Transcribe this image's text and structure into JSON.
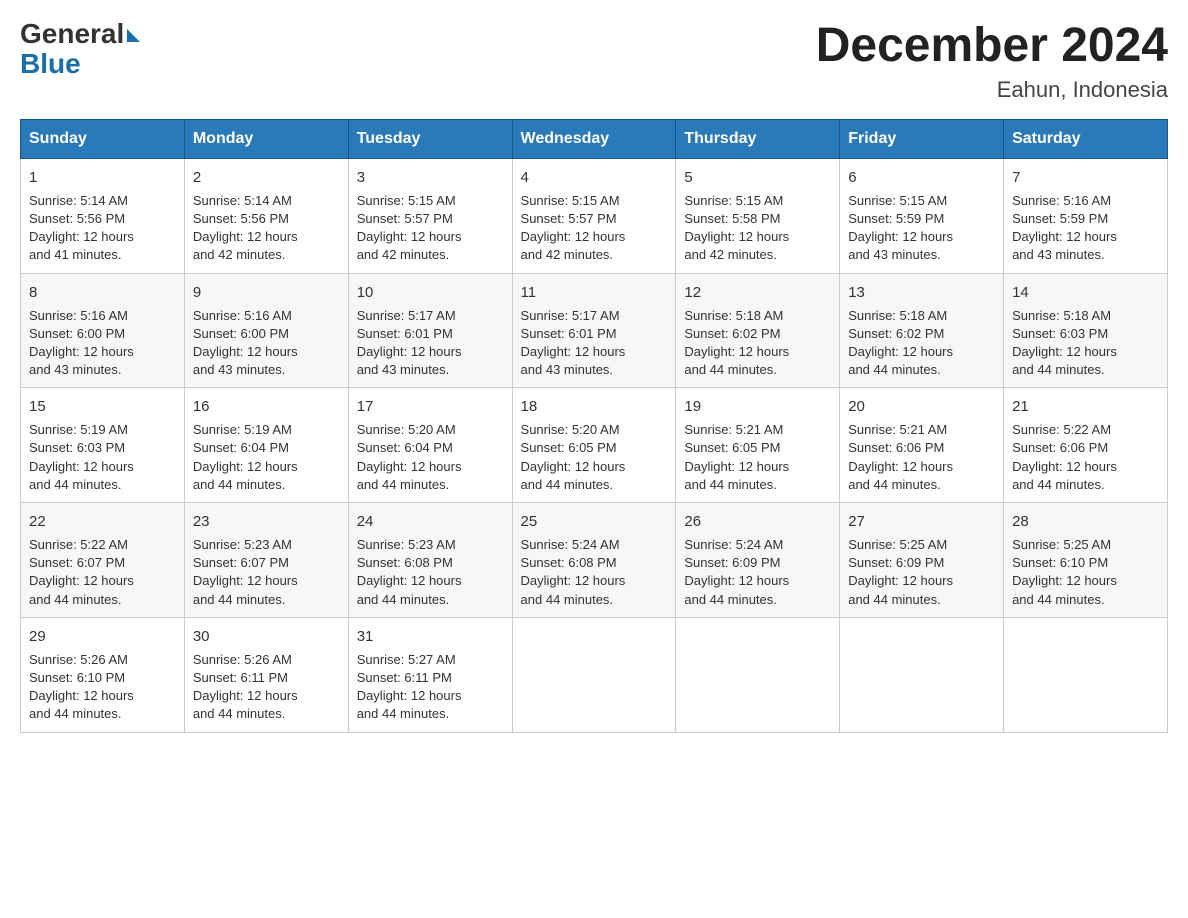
{
  "logo": {
    "general": "General",
    "blue": "Blue"
  },
  "header": {
    "month": "December 2024",
    "location": "Eahun, Indonesia"
  },
  "days_of_week": [
    "Sunday",
    "Monday",
    "Tuesday",
    "Wednesday",
    "Thursday",
    "Friday",
    "Saturday"
  ],
  "weeks": [
    [
      {
        "day": "1",
        "sunrise": "5:14 AM",
        "sunset": "5:56 PM",
        "daylight": "12 hours and 41 minutes."
      },
      {
        "day": "2",
        "sunrise": "5:14 AM",
        "sunset": "5:56 PM",
        "daylight": "12 hours and 42 minutes."
      },
      {
        "day": "3",
        "sunrise": "5:15 AM",
        "sunset": "5:57 PM",
        "daylight": "12 hours and 42 minutes."
      },
      {
        "day": "4",
        "sunrise": "5:15 AM",
        "sunset": "5:57 PM",
        "daylight": "12 hours and 42 minutes."
      },
      {
        "day": "5",
        "sunrise": "5:15 AM",
        "sunset": "5:58 PM",
        "daylight": "12 hours and 42 minutes."
      },
      {
        "day": "6",
        "sunrise": "5:15 AM",
        "sunset": "5:59 PM",
        "daylight": "12 hours and 43 minutes."
      },
      {
        "day": "7",
        "sunrise": "5:16 AM",
        "sunset": "5:59 PM",
        "daylight": "12 hours and 43 minutes."
      }
    ],
    [
      {
        "day": "8",
        "sunrise": "5:16 AM",
        "sunset": "6:00 PM",
        "daylight": "12 hours and 43 minutes."
      },
      {
        "day": "9",
        "sunrise": "5:16 AM",
        "sunset": "6:00 PM",
        "daylight": "12 hours and 43 minutes."
      },
      {
        "day": "10",
        "sunrise": "5:17 AM",
        "sunset": "6:01 PM",
        "daylight": "12 hours and 43 minutes."
      },
      {
        "day": "11",
        "sunrise": "5:17 AM",
        "sunset": "6:01 PM",
        "daylight": "12 hours and 43 minutes."
      },
      {
        "day": "12",
        "sunrise": "5:18 AM",
        "sunset": "6:02 PM",
        "daylight": "12 hours and 44 minutes."
      },
      {
        "day": "13",
        "sunrise": "5:18 AM",
        "sunset": "6:02 PM",
        "daylight": "12 hours and 44 minutes."
      },
      {
        "day": "14",
        "sunrise": "5:18 AM",
        "sunset": "6:03 PM",
        "daylight": "12 hours and 44 minutes."
      }
    ],
    [
      {
        "day": "15",
        "sunrise": "5:19 AM",
        "sunset": "6:03 PM",
        "daylight": "12 hours and 44 minutes."
      },
      {
        "day": "16",
        "sunrise": "5:19 AM",
        "sunset": "6:04 PM",
        "daylight": "12 hours and 44 minutes."
      },
      {
        "day": "17",
        "sunrise": "5:20 AM",
        "sunset": "6:04 PM",
        "daylight": "12 hours and 44 minutes."
      },
      {
        "day": "18",
        "sunrise": "5:20 AM",
        "sunset": "6:05 PM",
        "daylight": "12 hours and 44 minutes."
      },
      {
        "day": "19",
        "sunrise": "5:21 AM",
        "sunset": "6:05 PM",
        "daylight": "12 hours and 44 minutes."
      },
      {
        "day": "20",
        "sunrise": "5:21 AM",
        "sunset": "6:06 PM",
        "daylight": "12 hours and 44 minutes."
      },
      {
        "day": "21",
        "sunrise": "5:22 AM",
        "sunset": "6:06 PM",
        "daylight": "12 hours and 44 minutes."
      }
    ],
    [
      {
        "day": "22",
        "sunrise": "5:22 AM",
        "sunset": "6:07 PM",
        "daylight": "12 hours and 44 minutes."
      },
      {
        "day": "23",
        "sunrise": "5:23 AM",
        "sunset": "6:07 PM",
        "daylight": "12 hours and 44 minutes."
      },
      {
        "day": "24",
        "sunrise": "5:23 AM",
        "sunset": "6:08 PM",
        "daylight": "12 hours and 44 minutes."
      },
      {
        "day": "25",
        "sunrise": "5:24 AM",
        "sunset": "6:08 PM",
        "daylight": "12 hours and 44 minutes."
      },
      {
        "day": "26",
        "sunrise": "5:24 AM",
        "sunset": "6:09 PM",
        "daylight": "12 hours and 44 minutes."
      },
      {
        "day": "27",
        "sunrise": "5:25 AM",
        "sunset": "6:09 PM",
        "daylight": "12 hours and 44 minutes."
      },
      {
        "day": "28",
        "sunrise": "5:25 AM",
        "sunset": "6:10 PM",
        "daylight": "12 hours and 44 minutes."
      }
    ],
    [
      {
        "day": "29",
        "sunrise": "5:26 AM",
        "sunset": "6:10 PM",
        "daylight": "12 hours and 44 minutes."
      },
      {
        "day": "30",
        "sunrise": "5:26 AM",
        "sunset": "6:11 PM",
        "daylight": "12 hours and 44 minutes."
      },
      {
        "day": "31",
        "sunrise": "5:27 AM",
        "sunset": "6:11 PM",
        "daylight": "12 hours and 44 minutes."
      },
      null,
      null,
      null,
      null
    ]
  ],
  "labels": {
    "sunrise": "Sunrise:",
    "sunset": "Sunset:",
    "daylight": "Daylight:"
  }
}
